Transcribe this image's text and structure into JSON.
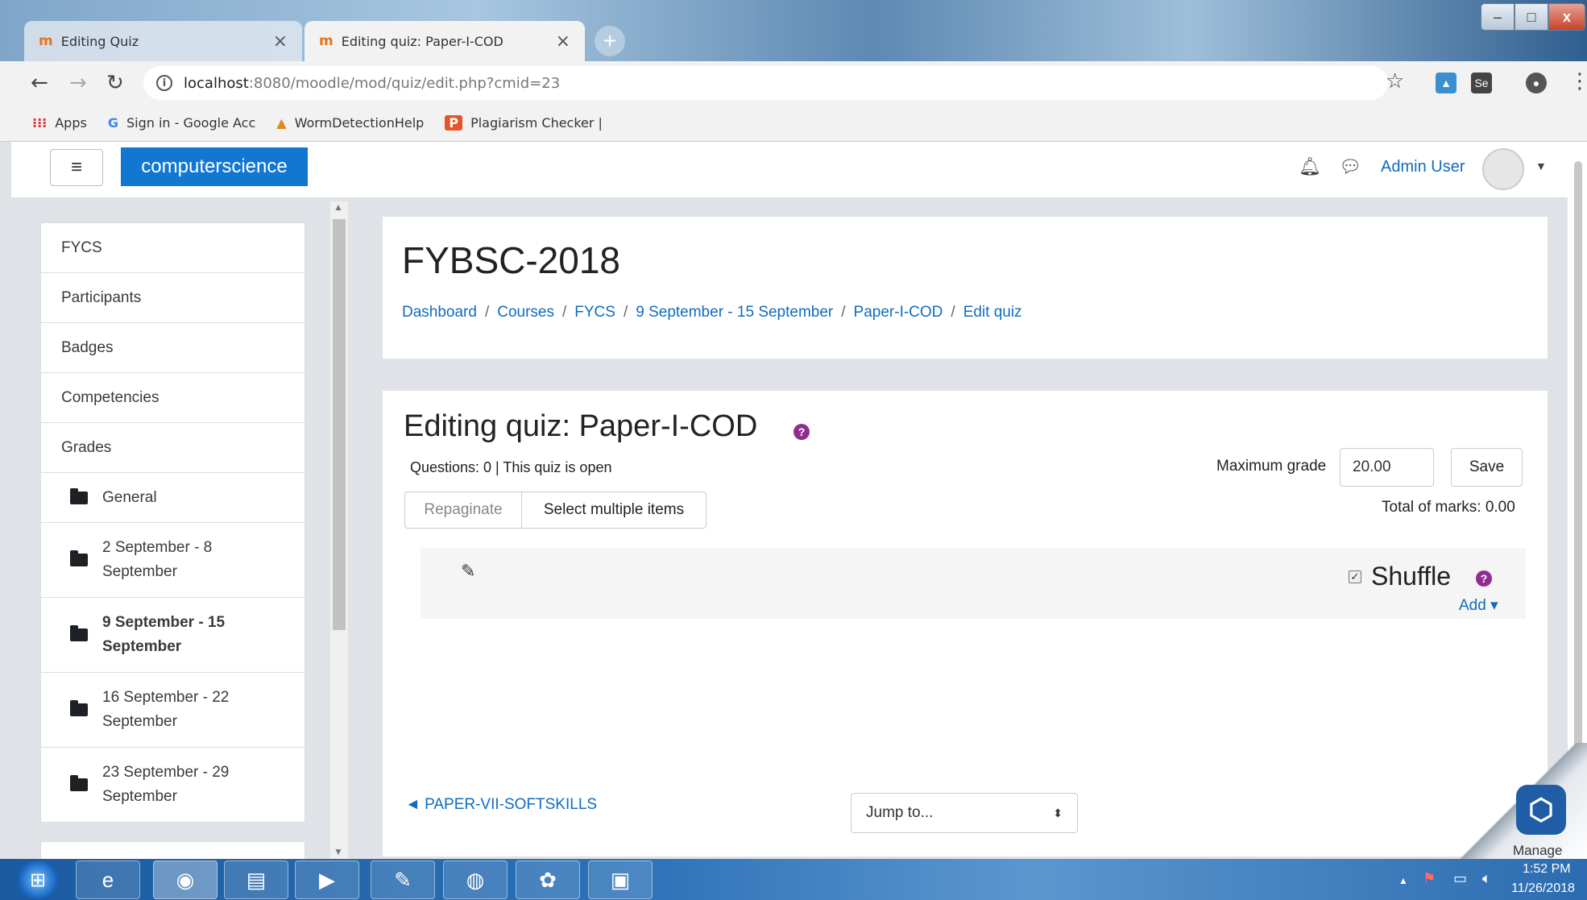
{
  "browser": {
    "tabs": [
      {
        "label": "Editing Quiz",
        "favicon": "moodle-icon"
      },
      {
        "label": "Editing quiz: Paper-I-COD",
        "favicon": "moodle-icon"
      }
    ],
    "url_host": "localhost",
    "url_path": ":8080/moodle/mod/quiz/edit.php?cmid=23",
    "bookmarks": [
      {
        "label": "Apps",
        "icon": "apps-grid-icon"
      },
      {
        "label": "Sign in - Google Acc",
        "icon": "google-icon"
      },
      {
        "label": "WormDetectionHelp",
        "icon": "worm-icon"
      },
      {
        "label": "Plagiarism Checker |",
        "icon": "plagiarism-icon"
      }
    ]
  },
  "moodle": {
    "brand": "computerscience",
    "user_name": "Admin User"
  },
  "drawer": {
    "items": [
      "FYCS",
      "Participants",
      "Badges",
      "Competencies",
      "Grades"
    ],
    "sections": [
      {
        "label": "General",
        "bold": false
      },
      {
        "label": "2 September - 8 September",
        "line1": "2 September - 8",
        "line2": "September",
        "bold": false
      },
      {
        "label": "9 September - 15 September",
        "line1": "9 September - 15",
        "line2": "September",
        "bold": true
      },
      {
        "label": "16 September - 22 September",
        "line1": "16 September - 22",
        "line2": "September",
        "bold": false
      },
      {
        "label": "23 September - 29 September",
        "line1": "23 September - 29",
        "line2": "September",
        "bold": false
      }
    ]
  },
  "header": {
    "course_title": "FYBSC-2018",
    "breadcrumb": [
      "Dashboard",
      "Courses",
      "FYCS",
      "9 September - 15 September",
      "Paper-I-COD",
      "Edit quiz"
    ]
  },
  "quiz": {
    "title": "Editing quiz: Paper-I-COD",
    "status": "Questions: 0 | This quiz is open",
    "repaginate_label": "Repaginate",
    "select_multiple_label": "Select multiple items",
    "max_grade_label": "Maximum grade",
    "max_grade_value": "20.00",
    "save_label": "Save",
    "total_marks": "Total of marks: 0.00",
    "shuffle_label": "Shuffle",
    "shuffle_checked": true,
    "add_label": "Add ▾",
    "prev_activity": "◄ PAPER-VII-SOFTSKILLS",
    "jump_placeholder": "Jump to..."
  },
  "overlay": {
    "manage_label": "Manage"
  },
  "taskbar": {
    "time": "1:52 PM",
    "date": "11/26/2018"
  },
  "colors": {
    "brand_blue": "#1177d1",
    "link_blue": "#0f6cbf",
    "help_purple": "#8f2e8f"
  }
}
